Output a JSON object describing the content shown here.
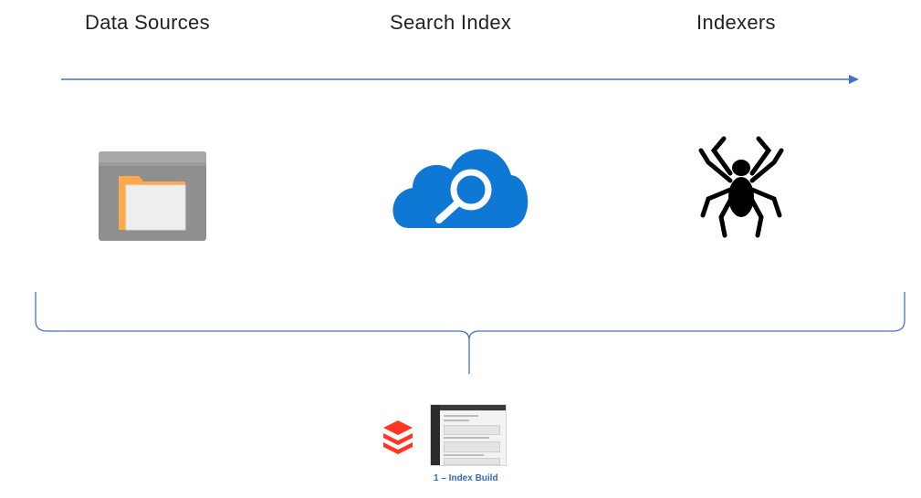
{
  "stages": {
    "data_sources": "Data Sources",
    "search_index": "Search Index",
    "indexers": "Indexers"
  },
  "icons": {
    "data_sources": "folder-icon",
    "search_index": "cloud-search-icon",
    "indexers": "spider-icon",
    "logo": "layered-stack-logo-icon",
    "thumbnail": "notebook-screenshot-thumbnail"
  },
  "colors": {
    "arrow": "#4472c4",
    "brace": "#4472c4",
    "cloud": "#0f78d4",
    "folder_front": "#ffa94d",
    "folder_box": "#8a8a8a",
    "logo": "#ff3621",
    "caption": "#2f6db5"
  },
  "caption": "1 – Index Build"
}
